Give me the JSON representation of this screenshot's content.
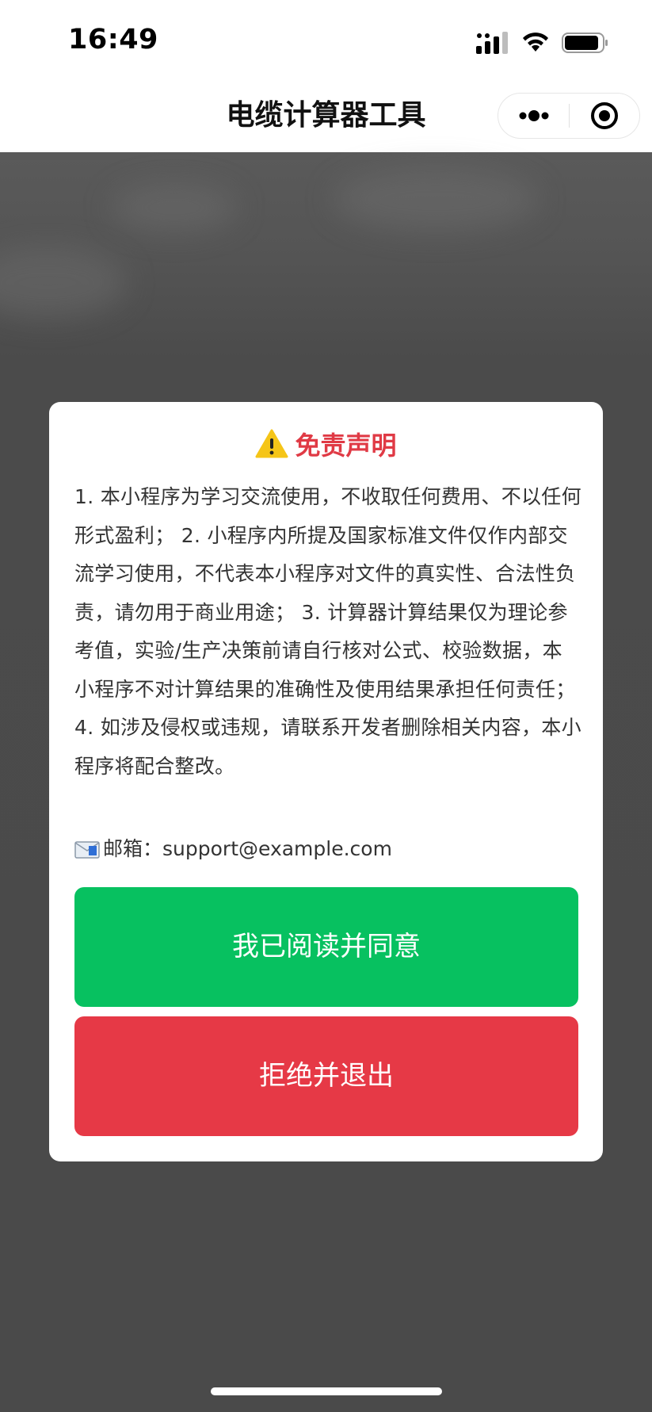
{
  "status_bar": {
    "time": "16:49",
    "icons": [
      "signal-icon",
      "wifi-icon",
      "battery-icon"
    ]
  },
  "nav": {
    "title": "电缆计算器工具",
    "capsule": [
      "more-icon",
      "close-mini-program-icon"
    ]
  },
  "modal": {
    "warning_icon": "warning-icon",
    "title": "免责声明",
    "body": "1. 本小程序为学习交流使用，不收取任何费用、不以任何形式盈利； 2. 小程序内所提及国家标准文件仅作内部交流学习使用，不代表本小程序对文件的真实性、合法性负责，请勿用于商业用途； 3. 计算器计算结果仅为理论参考值，实验/生产决策前请自行核对公式、校验数据，本小程序不对计算结果的准确性及使用结果承担任何责任； 4. 如涉及侵权或违规，请联系开发者删除相关内容，本小程序将配合整改。",
    "email_icon": "mail-icon",
    "email_label": "邮箱：",
    "email_value": "support@example.com",
    "agree_label": "我已阅读并同意",
    "reject_label": "拒绝并退出"
  },
  "colors": {
    "title_red": "#e03a45",
    "agree_green": "#07c160",
    "reject_red": "#e63946",
    "overlay": "#4a4a4a"
  }
}
